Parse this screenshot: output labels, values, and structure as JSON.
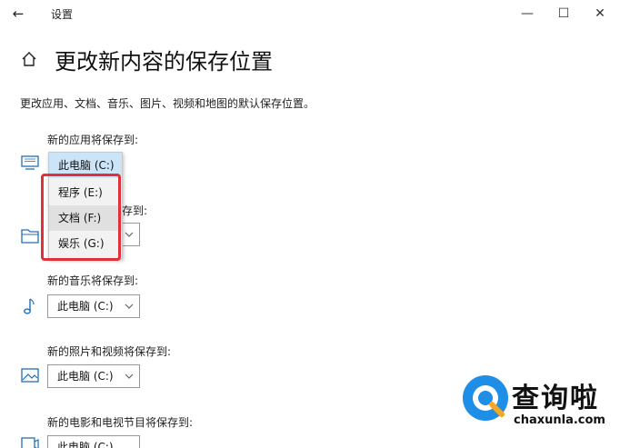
{
  "window": {
    "title": "设置",
    "back_glyph": "←",
    "minimize_glyph": "—",
    "maximize_glyph": "☐",
    "close_glyph": "✕"
  },
  "page": {
    "title": "更改新内容的保存位置",
    "description": "更改应用、文档、音乐、图片、视频和地图的默认保存位置。"
  },
  "rows": {
    "apps": {
      "label": "新的应用将保存到:",
      "value": "此电脑 (C:)"
    },
    "docs": {
      "label_partial": "存到:"
    },
    "music": {
      "label": "新的音乐将保存到:",
      "value": "此电脑 (C:)"
    },
    "photos": {
      "label": "新的照片和视频将保存到:",
      "value": "此电脑 (C:)"
    },
    "movies": {
      "label": "新的电影和电视节目将保存到:",
      "value": "此电脑 (C:)"
    }
  },
  "dropdown": {
    "options": [
      "此电脑 (C:)",
      "程序 (E:)",
      "文档 (F:)",
      "娱乐 (G:)"
    ]
  },
  "watermark": {
    "text": "查询啦",
    "domain": "chaxunla.com"
  },
  "colors": {
    "selected": "#cce4f7",
    "highlight": "#e0303a",
    "accent": "#1e8ee6"
  }
}
